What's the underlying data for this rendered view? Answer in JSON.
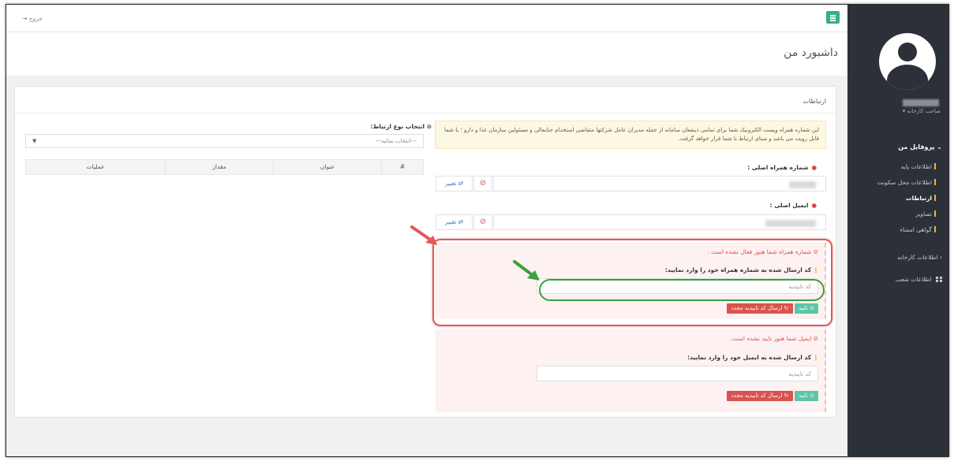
{
  "topbar": {
    "logout_label": "خروج"
  },
  "page": {
    "title": "داشبورد من"
  },
  "sidebar": {
    "user_role": "صاحب کارخانه ▾",
    "profile_menu": "پروفایل من",
    "profile_items": [
      {
        "label": "اطلاعات پایه"
      },
      {
        "label": "اطلاعات محل سکونت"
      },
      {
        "label": "ارتباطات"
      },
      {
        "label": "تصاویر"
      },
      {
        "label": "گواهی امضاء"
      }
    ],
    "factory_info": "اطلاعات کارخانه",
    "branches_info": "اطلاعات شعب"
  },
  "panel": {
    "title": "ارتباطات",
    "info_text": "این شماره همراه وپست الکترونیک شما برای تمامی ذینفعان سامانه از جمله مدیران عامل شرکتها متقاضی استخدام جتابعالی و مسئولین سازمان غذا و دارو ؛ با شما قابل رویت می باشد و مبنای ارتباط با شما قرار خواهد گرفت.",
    "mobile_label": "شماره همراه اصلی :",
    "email_label": "ایمیل اصلی :",
    "change_label": "تغییر",
    "mobile_warning": "شماره همراه شما هنوز فعال نشده است .",
    "mobile_code_label": "کد ارسال شده به شماره همراه خود را وارد نمایید:",
    "email_warning": "ایمیل شما هنوز تایید نشده است.",
    "email_code_label": "کد ارسال شده به ایمیل خود را وارد نمایید:",
    "code_placeholder": "کد تاییدیه",
    "confirm_label": "تایید",
    "resend_label": "ارسال کد تاییدیه مجدد",
    "type_select_label": "انتخاب نوع ارتباط:",
    "type_select_value": "---انتخاب نمائید---",
    "table_headers": [
      "#",
      "عنوان",
      "مقدار",
      "عملیات"
    ]
  },
  "colors": {
    "sidebar_bg": "#2c3038",
    "accent_green": "#36b37e",
    "danger_red": "#d9534f",
    "warning_bg": "#fcf8e3"
  }
}
